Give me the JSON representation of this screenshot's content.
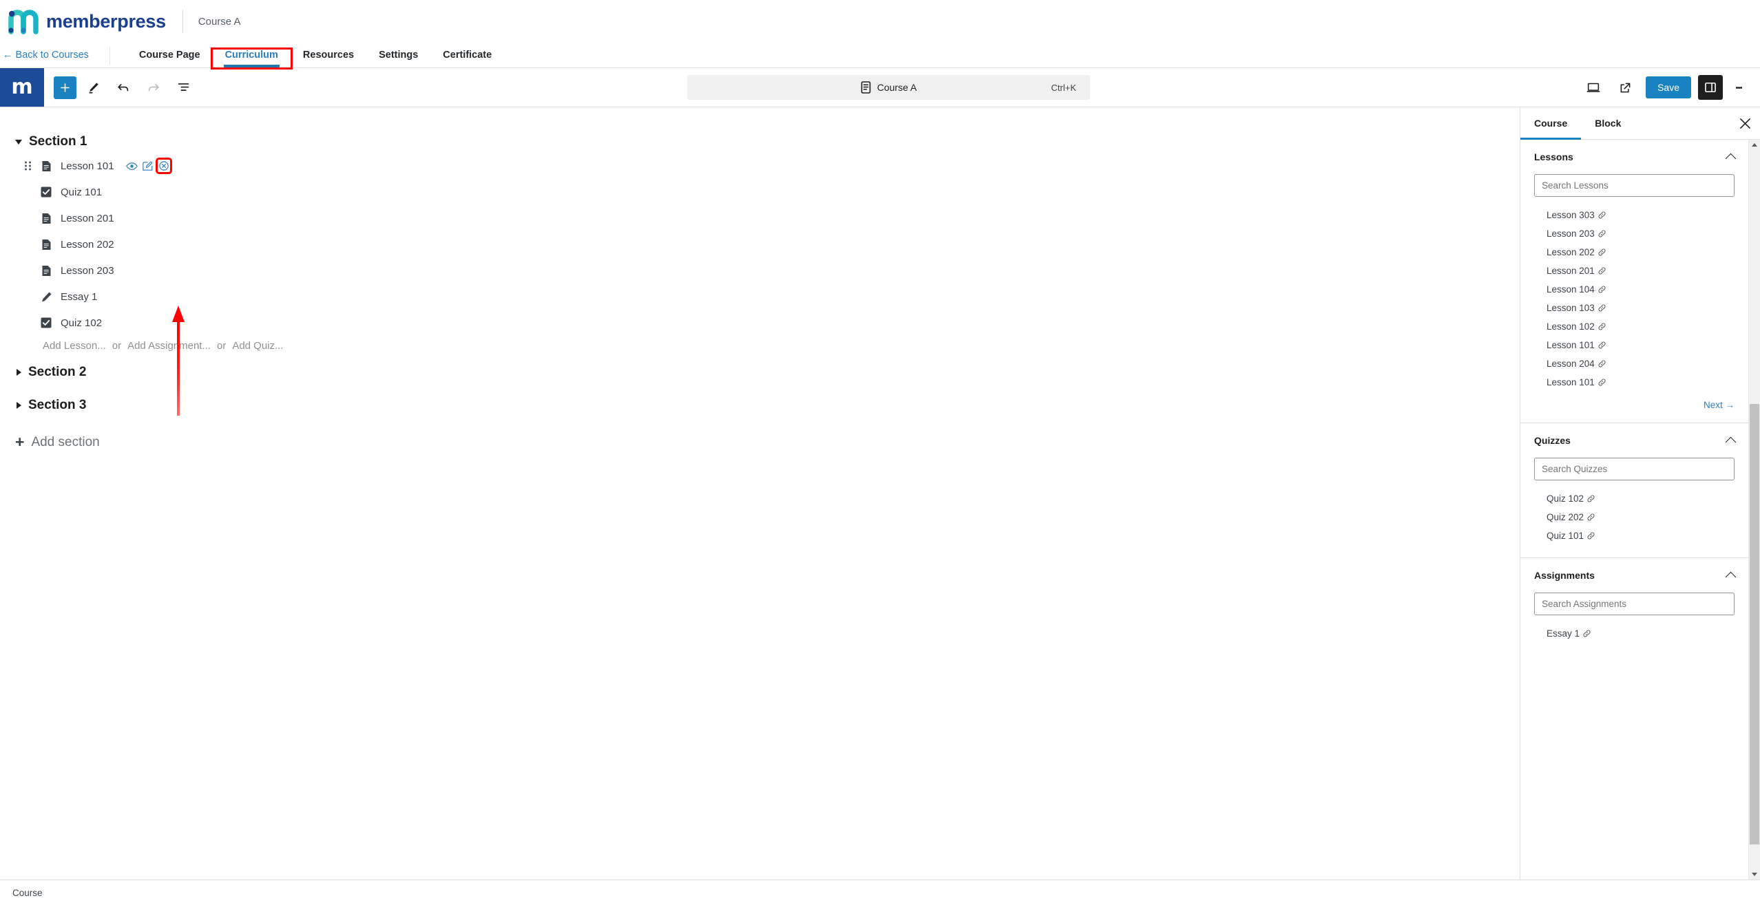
{
  "brand": {
    "logo_icon": "memberpress-logo-icon",
    "name": "memberpress",
    "course_name": "Course A"
  },
  "nav": {
    "back_label": "← Back to Courses",
    "tabs": [
      {
        "label": "Course Page",
        "active": false
      },
      {
        "label": "Curriculum",
        "active": true,
        "highlighted": true
      },
      {
        "label": "Resources",
        "active": false
      },
      {
        "label": "Settings",
        "active": false
      },
      {
        "label": "Certificate",
        "active": false
      }
    ]
  },
  "editor_toolbar": {
    "wp_logo_letter": "m",
    "add_block_icon": "plus-icon",
    "tools_icon": "pencil-icon",
    "undo_icon": "undo-arrow-icon",
    "redo_icon": "redo-arrow-icon",
    "list_view_icon": "document-outline-icon",
    "document_icon": "document-icon",
    "document_title": "Course A",
    "document_shortcut": "Ctrl+K",
    "view_icon": "desktop-preview-icon",
    "external_icon": "external-link-icon",
    "save_label": "Save",
    "sidebar_toggle_icon": "sidebar-panel-icon",
    "options_icon": "kebab-menu-icon",
    "accent_color": "#1b82c2"
  },
  "curriculum": {
    "sections": [
      {
        "title": "Section 1",
        "expanded": true,
        "items": [
          {
            "label": "Lesson 101",
            "type": "lesson",
            "icon": "document-icon",
            "selected": true,
            "actions": [
              {
                "name": "preview-icon",
                "icon": "eye-icon",
                "highlighted": false
              },
              {
                "name": "edit-icon",
                "icon": "pencil-square-icon",
                "highlighted": false
              },
              {
                "name": "remove-icon",
                "icon": "circle-x-icon",
                "highlighted": true
              }
            ]
          },
          {
            "label": "Quiz 101",
            "type": "quiz",
            "icon": "checkbox-checked-icon"
          },
          {
            "label": "Lesson 201",
            "type": "lesson",
            "icon": "document-icon"
          },
          {
            "label": "Lesson 202",
            "type": "lesson",
            "icon": "document-icon"
          },
          {
            "label": "Lesson 203",
            "type": "lesson",
            "icon": "document-icon"
          },
          {
            "label": "Essay 1",
            "type": "assignment",
            "icon": "pencil-icon"
          },
          {
            "label": "Quiz 102",
            "type": "quiz",
            "icon": "checkbox-checked-icon"
          }
        ],
        "add_row": {
          "add_lesson": "Add Lesson...",
          "or_1": "or",
          "add_assignment": "Add Assignment...",
          "or_2": "or",
          "add_quiz": "Add Quiz..."
        }
      },
      {
        "title": "Section 2",
        "expanded": false,
        "items": []
      },
      {
        "title": "Section 3",
        "expanded": false,
        "items": []
      }
    ],
    "add_section_label": "Add section",
    "add_section_icon": "plus-icon",
    "annotation_arrow": "red-arrow-pointing-to-remove-icon"
  },
  "right_panel": {
    "tabs": [
      {
        "label": "Course",
        "active": true
      },
      {
        "label": "Block",
        "active": false
      }
    ],
    "close_icon": "close-icon",
    "groups": [
      {
        "title": "Lessons",
        "collapse_icon": "chevron-up-icon",
        "search_placeholder": "Search Lessons",
        "search_value": "",
        "items": [
          "Lesson 303",
          "Lesson 203",
          "Lesson 202",
          "Lesson 201",
          "Lesson 104",
          "Lesson 103",
          "Lesson 102",
          "Lesson 101",
          "Lesson 204",
          "Lesson 101"
        ],
        "link_icon": "link-icon",
        "next_label": "Next →"
      },
      {
        "title": "Quizzes",
        "collapse_icon": "chevron-up-icon",
        "search_placeholder": "Search Quizzes",
        "search_value": "",
        "items": [
          "Quiz 102",
          "Quiz 202",
          "Quiz 101"
        ],
        "link_icon": "link-icon",
        "next_label": ""
      },
      {
        "title": "Assignments",
        "collapse_icon": "chevron-up-icon",
        "search_placeholder": "Search Assignments",
        "search_value": "",
        "items": [
          "Essay 1"
        ],
        "link_icon": "link-icon",
        "next_label": ""
      }
    ]
  },
  "status_bar": {
    "label": "Course"
  }
}
